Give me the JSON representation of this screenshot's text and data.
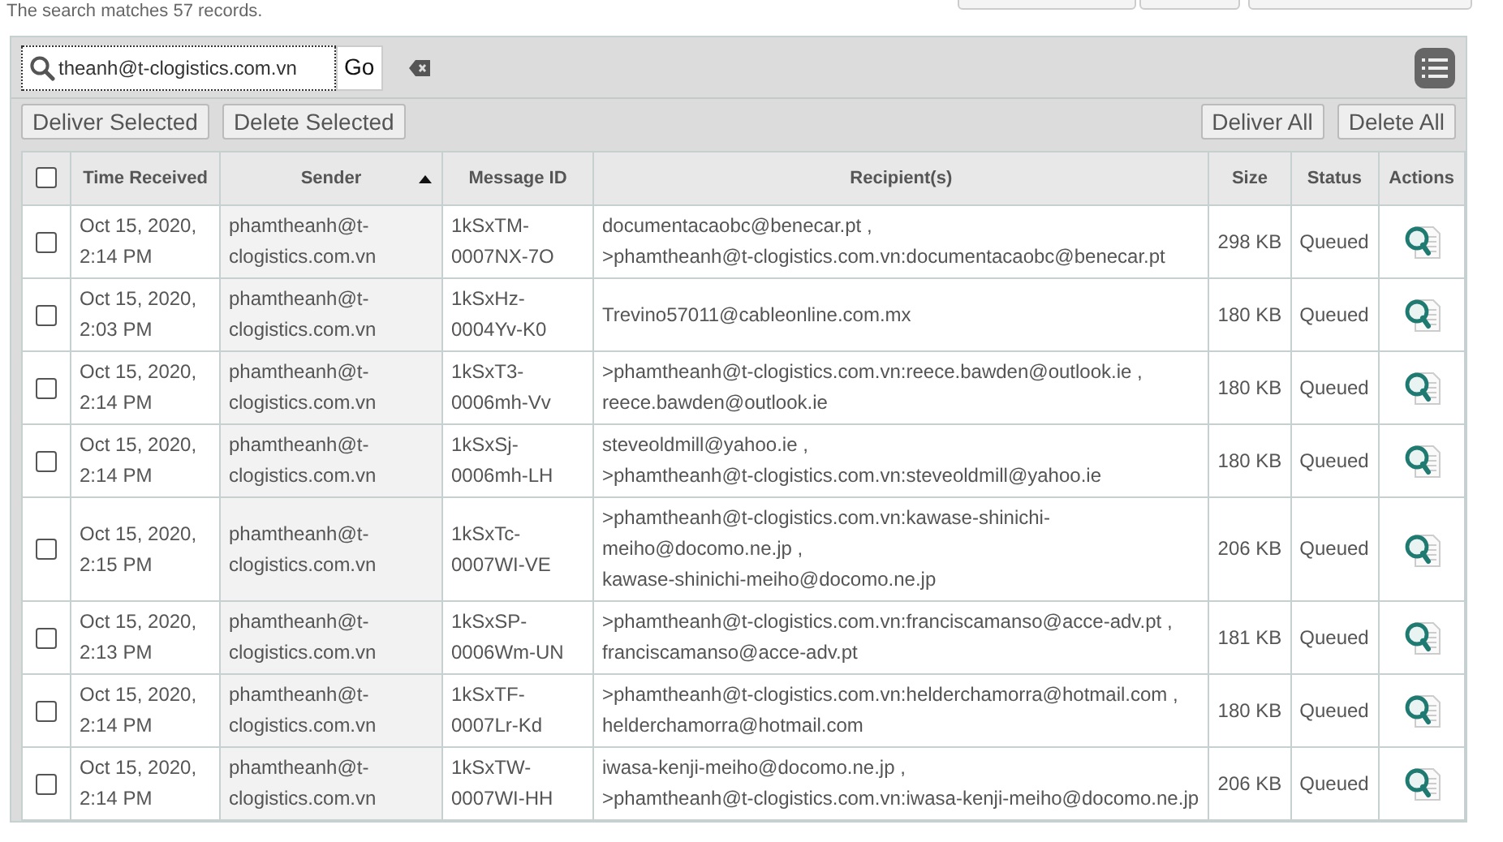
{
  "summary": "The search matches 57 records.",
  "search": {
    "value": "theanh@t-clogistics.com.vn",
    "go": "Go"
  },
  "actions_left": [
    "Deliver Selected",
    "Delete Selected"
  ],
  "actions_right": [
    "Deliver All",
    "Delete All"
  ],
  "table": {
    "select_all": {
      "checked": false
    },
    "columns": [
      {
        "label": "Time Received",
        "sorted": false
      },
      {
        "label": "Sender",
        "sorted": true
      },
      {
        "label": "Message ID",
        "sorted": false
      },
      {
        "label": "Recipient(s)",
        "sorted": false
      },
      {
        "label": "Size",
        "sorted": false
      },
      {
        "label": "Status",
        "sorted": false
      },
      {
        "label": "Actions",
        "sorted": false
      }
    ],
    "rows": [
      {
        "checked": false,
        "time": "Oct 15, 2020, 2:14 PM",
        "sender": "phamtheanh@t-clogistics.com.vn",
        "message_id": "1kSxTM-0007NX-7O",
        "recipients": [
          "documentacaobc@benecar.pt ,",
          ">phamtheanh@t-clogistics.com.vn:documentacaobc@benecar.pt"
        ],
        "size": "298 KB",
        "status": "Queued"
      },
      {
        "checked": false,
        "time": "Oct 15, 2020, 2:03 PM",
        "sender": "phamtheanh@t-clogistics.com.vn",
        "message_id": "1kSxHz-0004Yv-K0",
        "recipients": [
          "Trevino57011@cableonline.com.mx"
        ],
        "size": "180 KB",
        "status": "Queued"
      },
      {
        "checked": false,
        "time": "Oct 15, 2020, 2:14 PM",
        "sender": "phamtheanh@t-clogistics.com.vn",
        "message_id": "1kSxT3-0006mh-Vv",
        "recipients": [
          ">phamtheanh@t-clogistics.com.vn:reece.bawden@outlook.ie ,",
          "reece.bawden@outlook.ie"
        ],
        "size": "180 KB",
        "status": "Queued"
      },
      {
        "checked": false,
        "time": "Oct 15, 2020, 2:14 PM",
        "sender": "phamtheanh@t-clogistics.com.vn",
        "message_id": "1kSxSj-0006mh-LH",
        "recipients": [
          "steveoldmill@yahoo.ie ,",
          ">phamtheanh@t-clogistics.com.vn:steveoldmill@yahoo.ie"
        ],
        "size": "180 KB",
        "status": "Queued"
      },
      {
        "checked": false,
        "time": "Oct 15, 2020, 2:15 PM",
        "sender": "phamtheanh@t-clogistics.com.vn",
        "message_id": "1kSxTc-0007WI-VE",
        "recipients": [
          ">phamtheanh@t-clogistics.com.vn:kawase-shinichi-meiho@docomo.ne.jp ,",
          "kawase-shinichi-meiho@docomo.ne.jp"
        ],
        "size": "206 KB",
        "status": "Queued"
      },
      {
        "checked": false,
        "time": "Oct 15, 2020, 2:13 PM",
        "sender": "phamtheanh@t-clogistics.com.vn",
        "message_id": "1kSxSP-0006Wm-UN",
        "recipients": [
          ">phamtheanh@t-clogistics.com.vn:franciscamanso@acce-adv.pt ,",
          "franciscamanso@acce-adv.pt"
        ],
        "size": "181 KB",
        "status": "Queued"
      },
      {
        "checked": false,
        "time": "Oct 15, 2020, 2:14 PM",
        "sender": "phamtheanh@t-clogistics.com.vn",
        "message_id": "1kSxTF-0007Lr-Kd",
        "recipients": [
          ">phamtheanh@t-clogistics.com.vn:helderchamorra@hotmail.com ,",
          "helderchamorra@hotmail.com"
        ],
        "size": "180 KB",
        "status": "Queued"
      },
      {
        "checked": false,
        "time": "Oct 15, 2020, 2:14 PM",
        "sender": "phamtheanh@t-clogistics.com.vn",
        "message_id": "1kSxTW-0007WI-HH",
        "recipients": [
          "iwasa-kenji-meiho@docomo.ne.jp ,",
          ">phamtheanh@t-clogistics.com.vn:iwasa-kenji-meiho@docomo.ne.jp"
        ],
        "size": "206 KB",
        "status": "Queued"
      }
    ]
  }
}
